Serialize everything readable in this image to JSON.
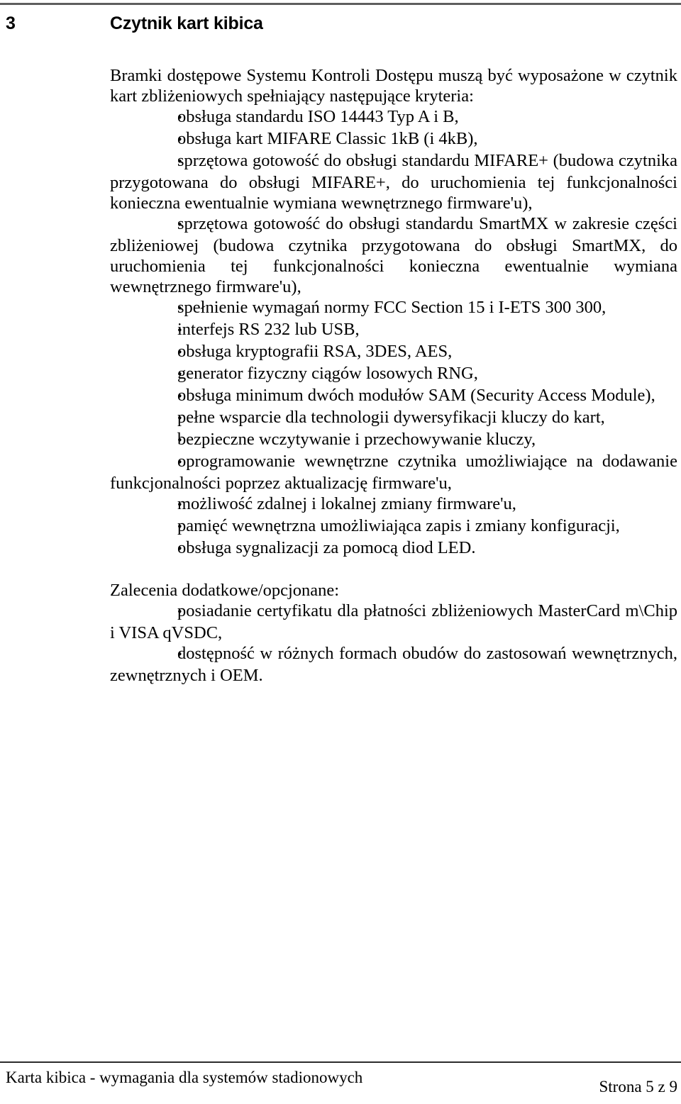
{
  "document": {
    "section_number": "3",
    "section_title": "Czytnik kart kibica"
  },
  "body": {
    "intro": "Bramki dostępowe Systemu Kontroli Dostępu muszą być wyposażone w czytnik kart zbliżeniowych spełniający następujące kryteria:",
    "bullet_char": "•",
    "requirements": [
      "obsługa standardu ISO 14443 Typ A i B,",
      "obsługa kart MIFARE Classic 1kB (i 4kB),",
      "sprzętowa gotowość do obsługi standardu MIFARE+ (budowa czytnika przygotowana do obsługi MIFARE+, do uruchomienia tej funkcjonalności konieczna ewentualnie wymiana wewnętrznego firmware'u),",
      "sprzętowa gotowość do obsługi standardu SmartMX w zakresie części zbliżeniowej (budowa czytnika przygotowana do obsługi SmartMX, do uruchomienia tej funkcjonalności konieczna ewentualnie wymiana wewnętrznego firmware'u),",
      "spełnienie wymagań normy FCC Section 15 i I-ETS 300 300,",
      "interfejs RS 232 lub USB,",
      "obsługa kryptografii RSA, 3DES, AES,",
      "generator fizyczny ciągów losowych RNG,",
      "obsługa minimum dwóch modułów SAM (Security Access Module),",
      "pełne wsparcie dla technologii dywersyfikacji kluczy do kart,",
      "bezpieczne wczytywanie i przechowywanie kluczy,",
      "oprogramowanie wewnętrzne czytnika  umożliwiające na dodawanie funkcjonalności poprzez aktualizację firmware'u,",
      "możliwość zdalnej i lokalnej zmiany firmware'u,",
      "pamięć wewnętrzna umożliwiająca zapis i zmiany konfiguracji,",
      "obsługa sygnalizacji za pomocą diod LED."
    ],
    "optional_heading": "Zalecenia dodatkowe/opcjonane:",
    "optional_items": [
      "posiadanie certyfikatu dla płatności zbliżeniowych MasterCard m\\Chip i VISA qVSDC,",
      "dostępność w różnych formach obudów do zastosowań wewnętrznych, zewnętrznych i OEM."
    ]
  },
  "footer": {
    "left_text": "Karta kibica - wymagania dla systemów stadionowych",
    "page_label": "Strona 5 z 9"
  }
}
